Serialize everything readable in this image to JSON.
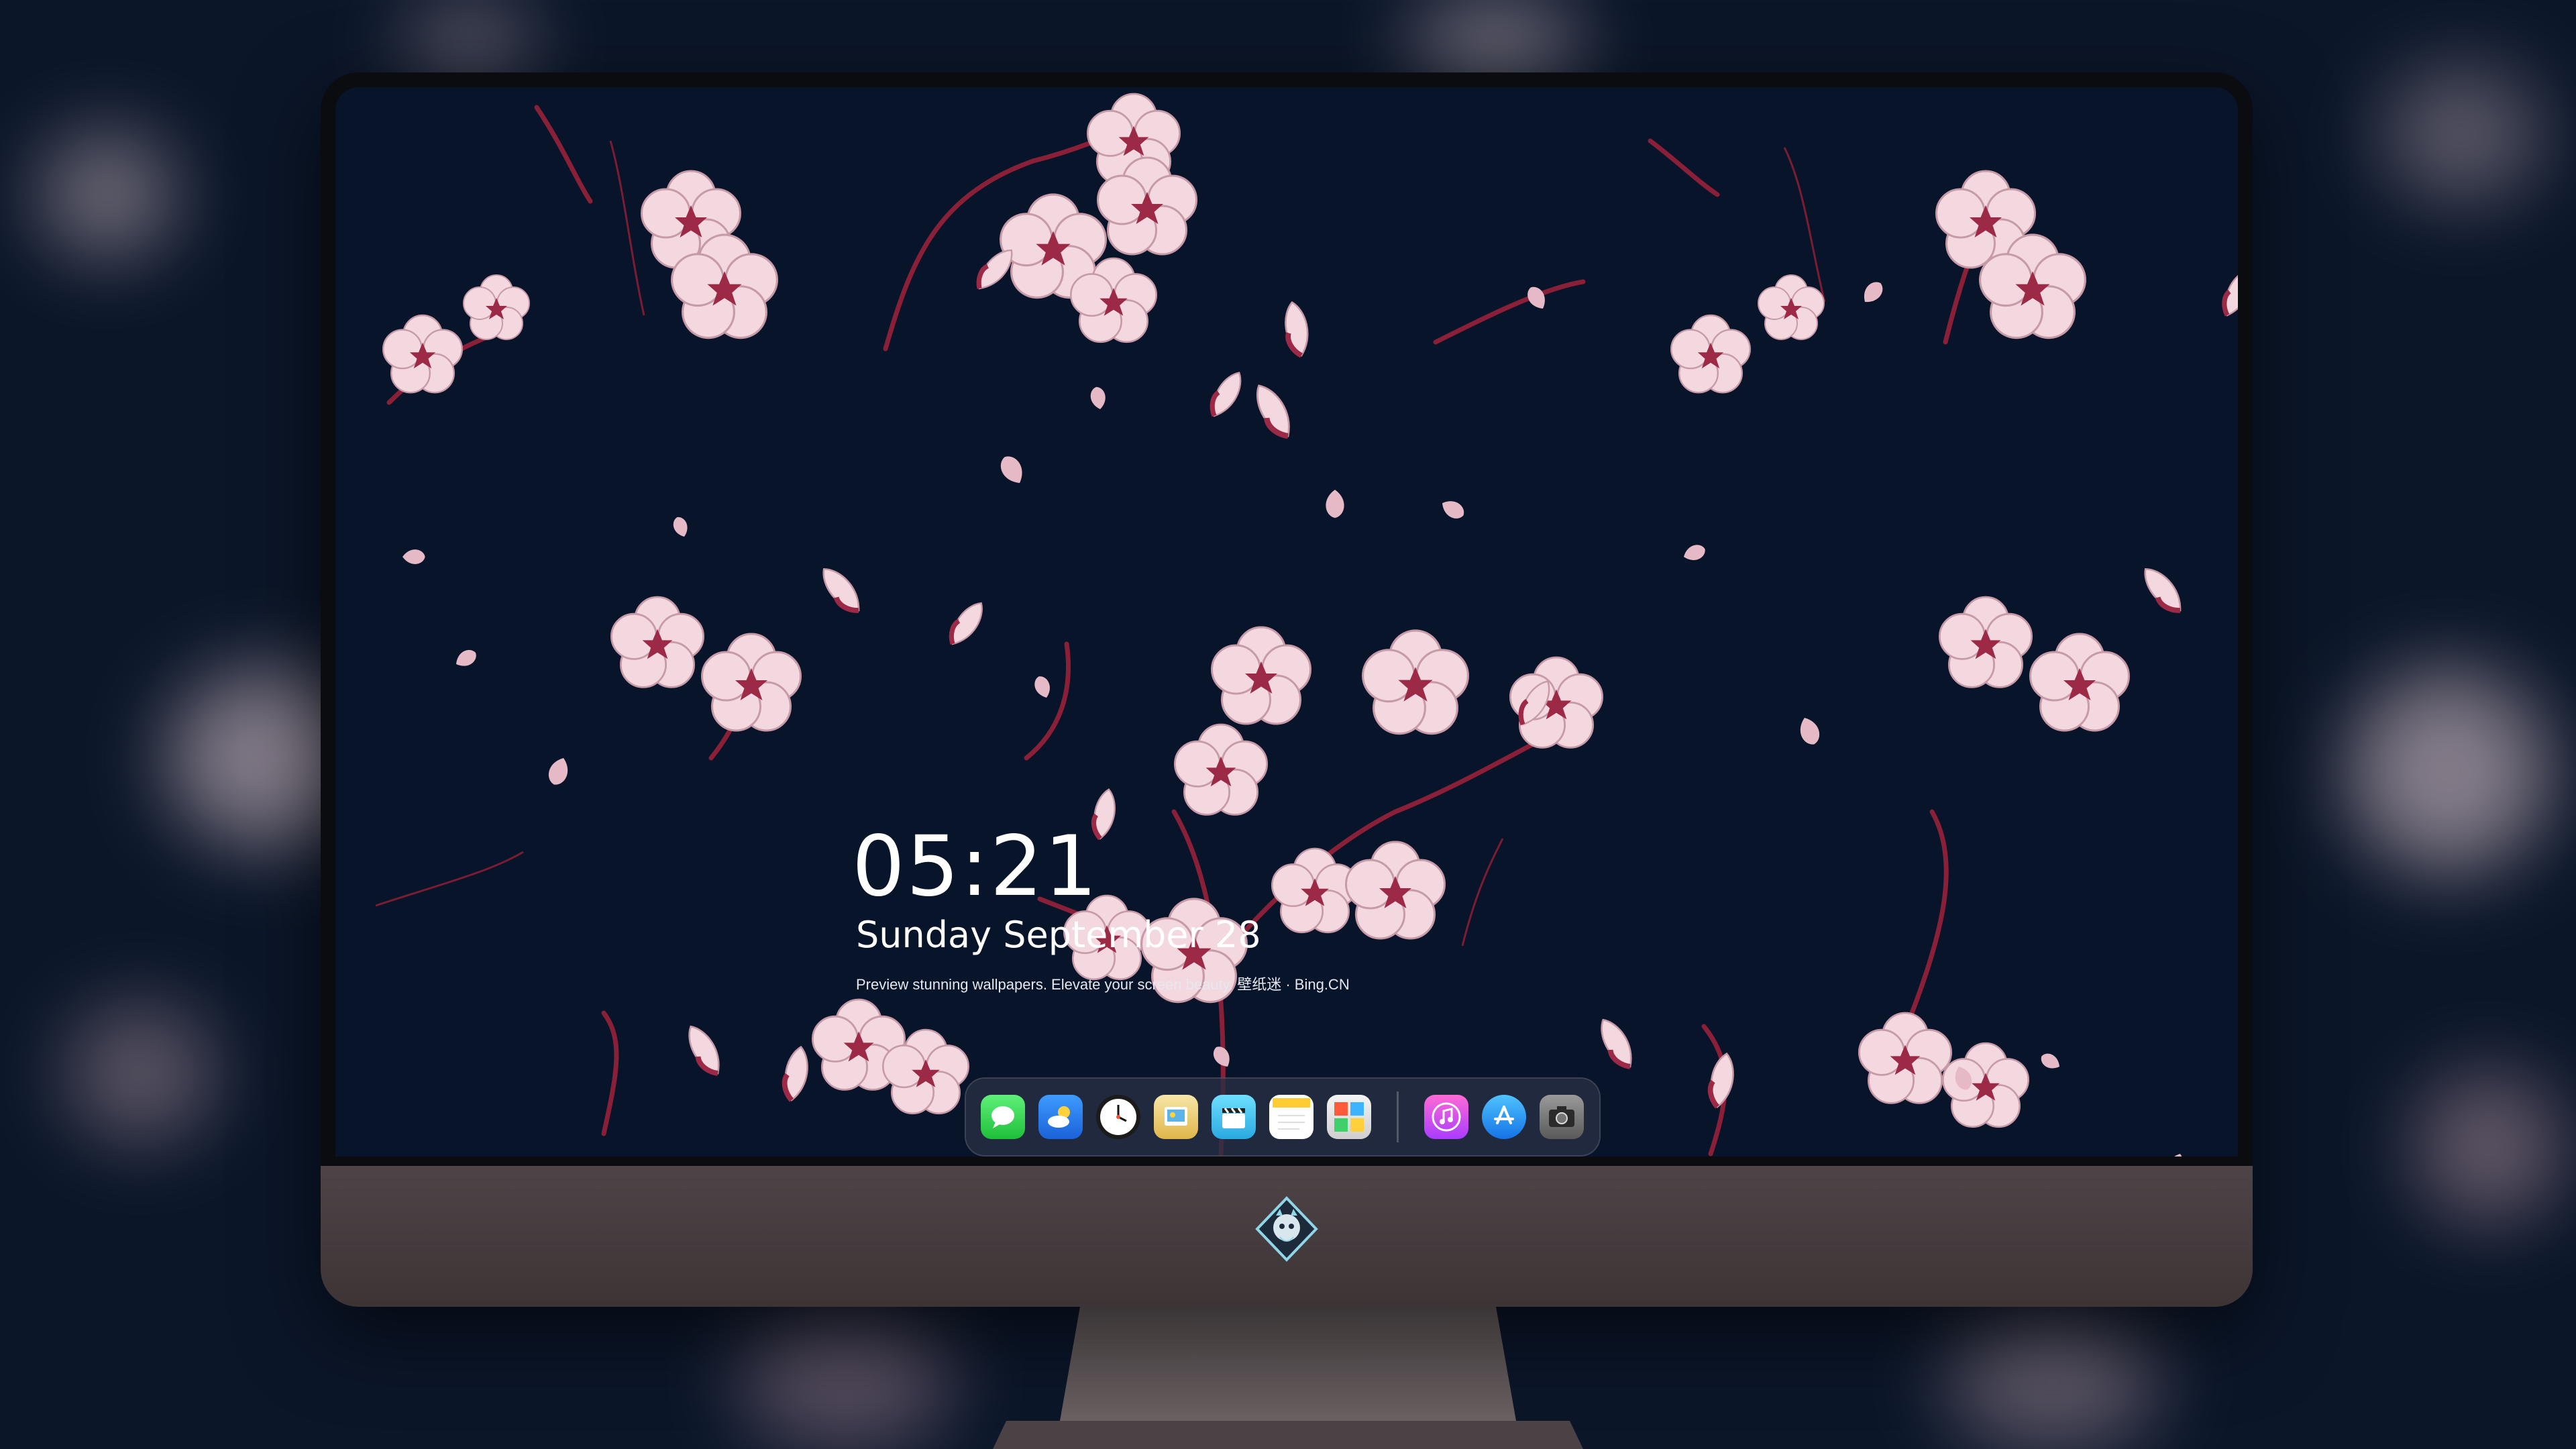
{
  "lockscreen": {
    "time": "05:21",
    "date": "Sunday September  28",
    "tagline": "Preview stunning wallpapers. Elevate your screen beauty. 壁纸迷 · Bing.CN"
  },
  "dock": {
    "apps": [
      {
        "name": "Messages",
        "icon": "messages-icon"
      },
      {
        "name": "Weather",
        "icon": "weather-icon"
      },
      {
        "name": "Clock",
        "icon": "clock-icon"
      },
      {
        "name": "Preview",
        "icon": "preview-icon"
      },
      {
        "name": "Clips",
        "icon": "clips-icon"
      },
      {
        "name": "Notes",
        "icon": "notes-icon"
      },
      {
        "name": "Photo Booth",
        "icon": "photo-booth-icon"
      },
      {
        "name": "iTunes",
        "icon": "itunes-icon"
      },
      {
        "name": "App Store",
        "icon": "app-store-icon"
      },
      {
        "name": "Camera",
        "icon": "camera-icon"
      }
    ]
  },
  "colors": {
    "wallpaper_bg": "#071429",
    "blossom": "#f4d8e0",
    "blossom_center": "#9c2a47",
    "branch": "#8a2038",
    "bezel": "#0a0c10",
    "chin": "#463c3f"
  }
}
